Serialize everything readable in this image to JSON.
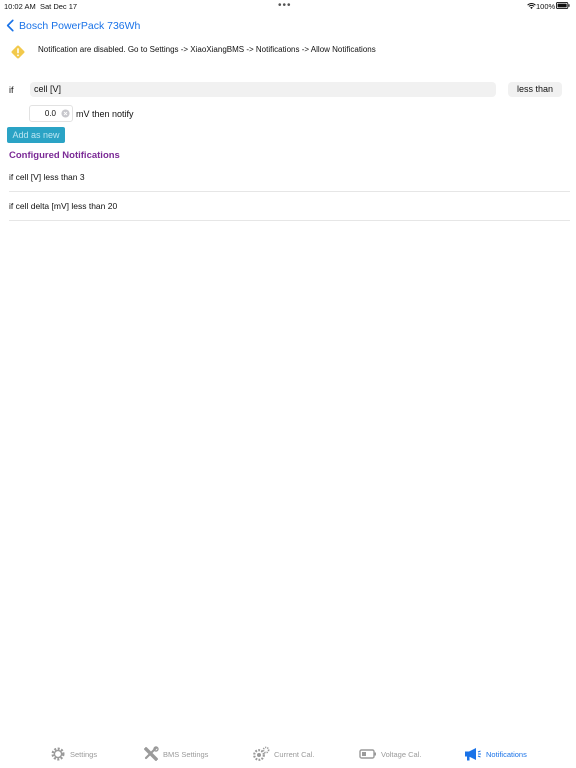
{
  "status_bar": {
    "time": "10:02 AM",
    "date": "Sat Dec 17",
    "dots": "•••",
    "battery": "100%"
  },
  "nav": {
    "title": "Bosch PowerPack 736Wh"
  },
  "warning": {
    "text": "Notification are disabled. Go to Settings -> XiaoXiangBMS -> Notifications -> Allow Notifications"
  },
  "form": {
    "if_label": "if",
    "parameter": "cell [V]",
    "comparison": "less than",
    "value": "0.0",
    "unit_then": "mV  then notify",
    "add_button": "Add as new"
  },
  "configured": {
    "title": "Configured Notifications",
    "items": [
      "if cell [V] less than 3",
      "if cell delta [mV] less than 20"
    ]
  },
  "tabs": [
    {
      "label": "Settings",
      "icon": "gear-icon"
    },
    {
      "label": "BMS Settings",
      "icon": "tools-icon"
    },
    {
      "label": "Current Cal.",
      "icon": "gears-icon"
    },
    {
      "label": "Voltage Cal.",
      "icon": "battery-icon"
    },
    {
      "label": "Notifications",
      "icon": "megaphone-icon"
    }
  ],
  "colors": {
    "accent": "#1a73e8",
    "section_title": "#7b2a96",
    "button": "#2aa3c5",
    "warning": "#f2c94c"
  }
}
